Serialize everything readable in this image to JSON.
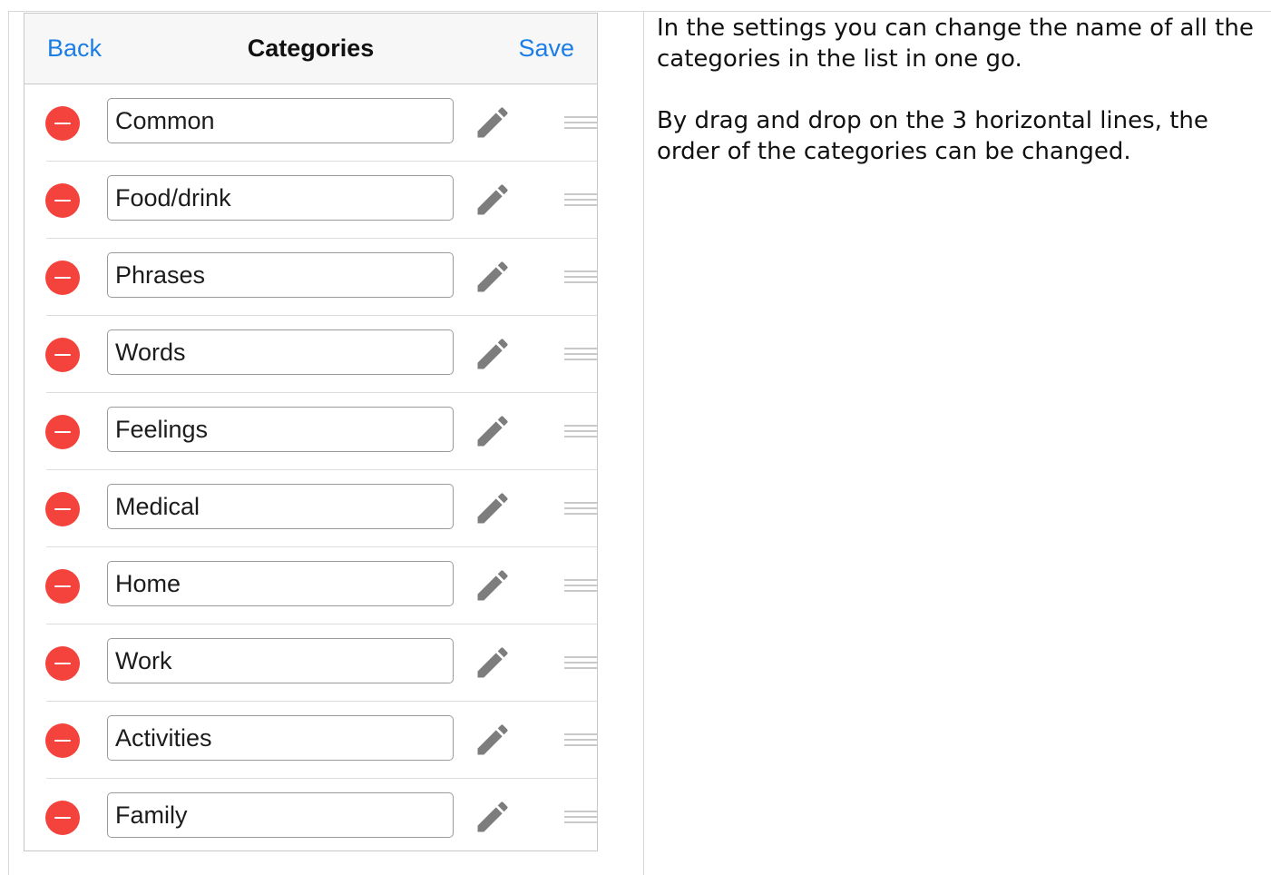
{
  "navbar": {
    "back_label": "Back",
    "title": "Categories",
    "save_label": "Save"
  },
  "categories": [
    "Common",
    "Food/drink",
    "Phrases",
    "Words",
    "Feelings",
    "Medical",
    "Home",
    "Work",
    "Activities",
    "Family"
  ],
  "explanation": {
    "paragraph_1": "In the settings you can change the name of all the categories in the list in one go.",
    "paragraph_2": "By drag and drop on the 3 horizontal lines, the order of the categories can be changed."
  },
  "colors": {
    "accent": "#1a7ee6",
    "delete": "#f4433c",
    "icon": "#7d7d7d"
  },
  "icons": {
    "delete": "minus-circle-icon",
    "edit": "pencil-icon",
    "reorder": "drag-handle-icon"
  }
}
